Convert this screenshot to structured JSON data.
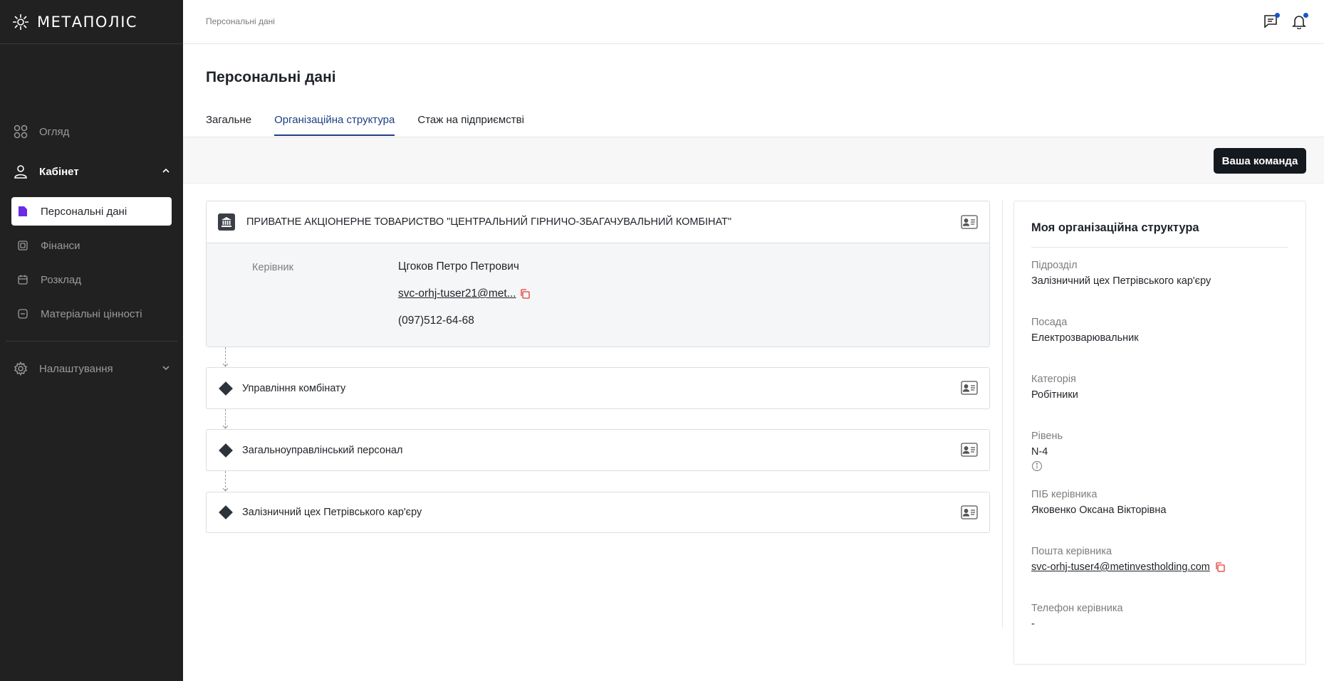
{
  "app": {
    "logo_text": "МЕТАПОЛІС"
  },
  "sidebar": {
    "items": [
      {
        "label": "Огляд",
        "icon": "grid-icon"
      },
      {
        "label": "Кабінет",
        "icon": "user-icon"
      },
      {
        "label": "Налаштування",
        "icon": "gear-icon"
      }
    ],
    "sub_items": [
      {
        "label": "Персональні дані",
        "icon": "document-icon",
        "active": true
      },
      {
        "label": "Фінанси",
        "icon": "wallet-icon"
      },
      {
        "label": "Розклад",
        "icon": "calendar-icon"
      },
      {
        "label": "Матеріальні цінності",
        "icon": "box-icon"
      }
    ]
  },
  "header": {
    "breadcrumb": "Персональні дані"
  },
  "page": {
    "title": "Персональні дані"
  },
  "tabs": [
    {
      "label": "Загальне"
    },
    {
      "label": "Організаційна структура",
      "active": true
    },
    {
      "label": "Стаж на підприємстві"
    }
  ],
  "actions": {
    "team_button": "Ваша команда"
  },
  "org": {
    "company": "ПРИВАТНЕ АКЦІОНЕРНЕ ТОВАРИСТВО \"ЦЕНТРАЛЬНИЙ ГІРНИЧО-ЗБАГАЧУВАЛЬНИЙ КОМБІНАТ\"",
    "head_label": "Керівник",
    "head_name": "Цгоков Петро Петрович",
    "head_email": "svc-orhj-tuser21@met...",
    "head_phone": "(097)512-64-68",
    "units": [
      {
        "title": "Управління комбінату"
      },
      {
        "title": "Загальноуправлінський персонал"
      },
      {
        "title": "Залізничний цех Петрівського кар'єру"
      }
    ]
  },
  "my_structure": {
    "title": "Моя організаційна структура",
    "fields": [
      {
        "label": "Підрозділ",
        "value": "Залізничний цех Петрівського кар'єру"
      },
      {
        "label": "Посада",
        "value": "Електрозварювальник"
      },
      {
        "label": "Категорія",
        "value": "Робітники"
      },
      {
        "label": "Рівень",
        "value": "N-4"
      },
      {
        "label": "ПІБ керівника",
        "value": "Яковенко Оксана Вікторівна"
      },
      {
        "label": "Пошта керівника",
        "value": "svc-orhj-tuser4@metinvestholding.com"
      },
      {
        "label": "Телефон керівника",
        "value": "-"
      }
    ]
  },
  "colors": {
    "accent": "#1d3f84",
    "sidebar_bg": "#212121",
    "notification_dot": "#1554d6",
    "copy_icon": "#e53935"
  }
}
